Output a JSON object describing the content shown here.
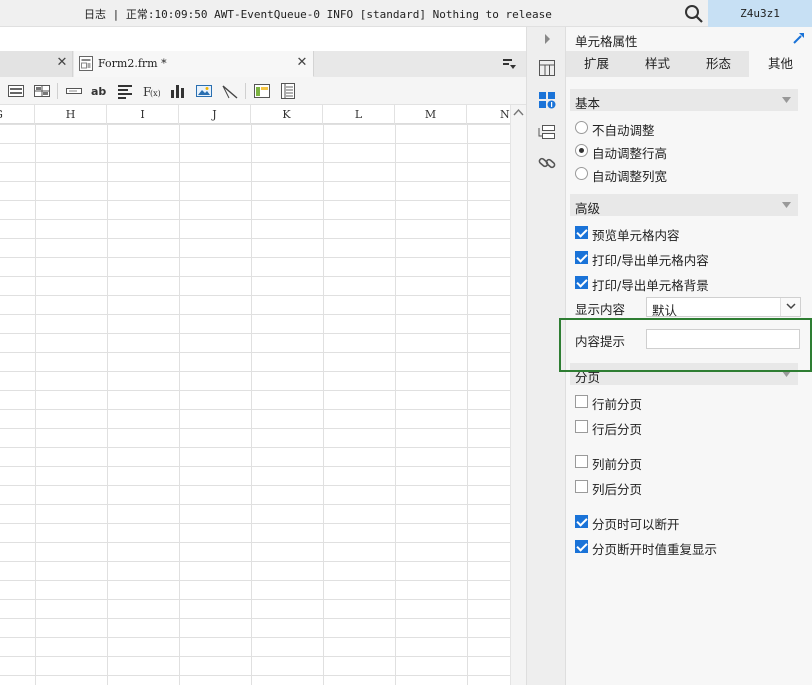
{
  "status": {
    "text": "日志 | 正常:10:09:50 AWT-EventQueue-0 INFO [standard] Nothing to release",
    "user": "Z4u3z1"
  },
  "editor": {
    "tabs": [
      {
        "label": ""
      },
      {
        "label": "Form2.frm *"
      }
    ],
    "columns": [
      "G",
      "H",
      "I",
      "J",
      "K",
      "L",
      "M",
      "N"
    ]
  },
  "panel": {
    "title": "单元格属性",
    "tabs": [
      "扩展",
      "样式",
      "形态",
      "其他"
    ],
    "active_tab": "其他",
    "basic": {
      "label": "基本",
      "options": [
        {
          "label": "不自动调整",
          "selected": false
        },
        {
          "label": "自动调整行高",
          "selected": true
        },
        {
          "label": "自动调整列宽",
          "selected": false
        }
      ]
    },
    "advanced": {
      "label": "高级",
      "checks": [
        {
          "label": "预览单元格内容",
          "checked": true
        },
        {
          "label": "打印/导出单元格内容",
          "checked": true
        },
        {
          "label": "打印/导出单元格背景",
          "checked": true
        }
      ],
      "display_label": "显示内容",
      "display_value": "默认",
      "tip_label": "内容提示",
      "tip_value": ""
    },
    "paging": {
      "label": "分页",
      "checks": [
        {
          "label": "行前分页",
          "checked": false
        },
        {
          "label": "行后分页",
          "checked": false
        },
        {
          "label": "列前分页",
          "checked": false
        },
        {
          "label": "列后分页",
          "checked": false
        },
        {
          "label": "分页时可以断开",
          "checked": true
        },
        {
          "label": "分页断开时值重复显示",
          "checked": true
        }
      ]
    }
  },
  "colors": {
    "accent": "#1a73d8",
    "highlight": "#2e7d32",
    "user_box": "#c7e0f4"
  }
}
